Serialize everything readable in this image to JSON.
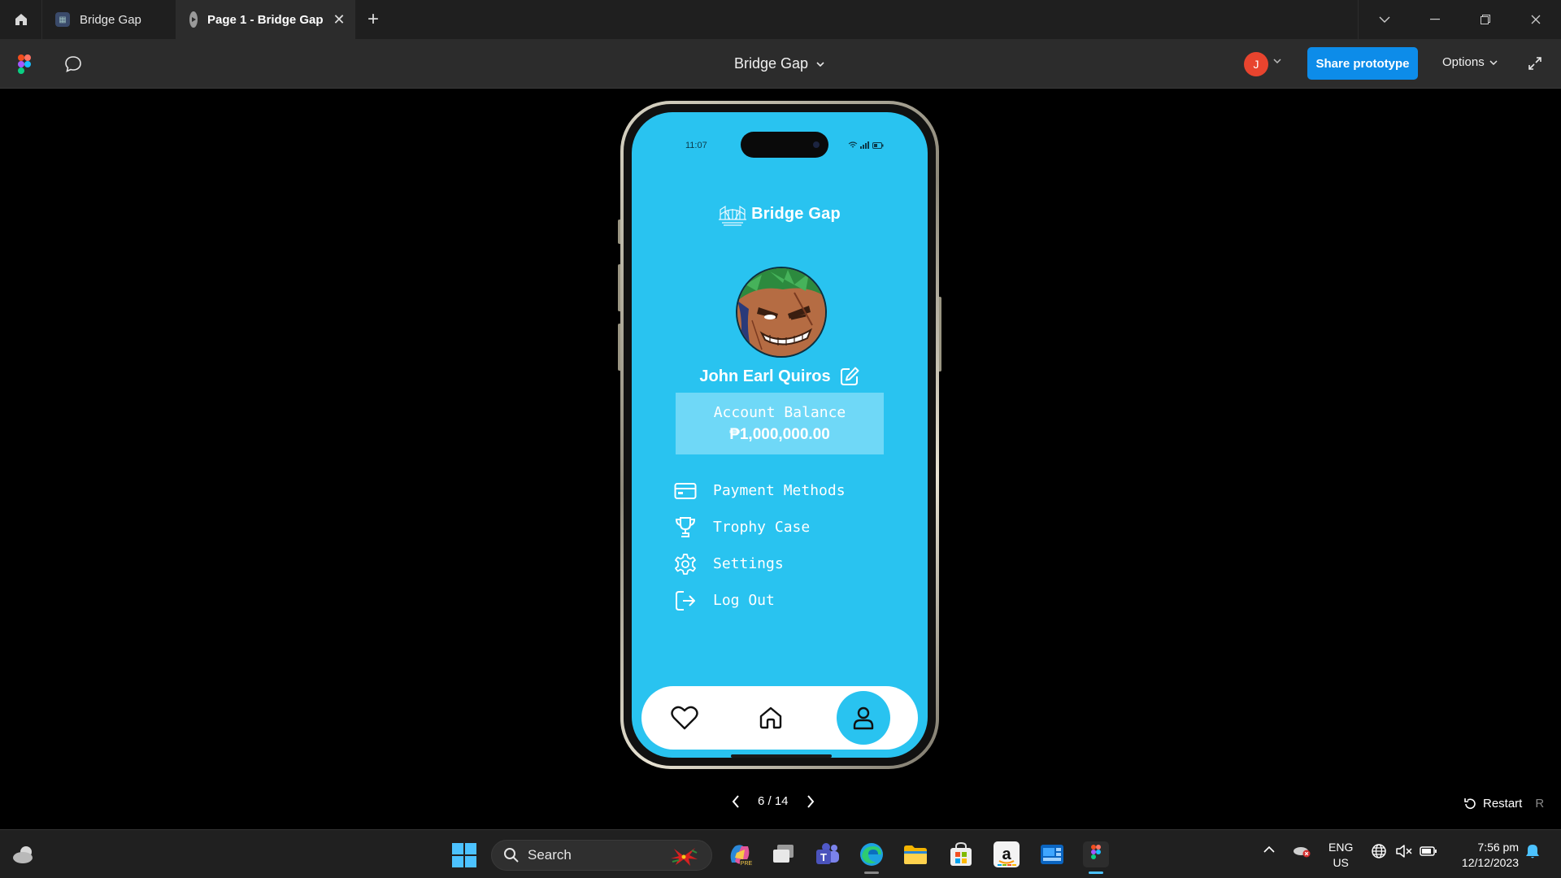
{
  "browser": {
    "tabs": [
      {
        "label": "Bridge Gap",
        "active": false
      },
      {
        "label": "Page 1 - Bridge Gap",
        "active": true
      }
    ]
  },
  "toolbar": {
    "file_title": "Bridge Gap",
    "user_initial": "J",
    "share_label": "Share prototype",
    "options_label": "Options"
  },
  "phone": {
    "status_time": "11:07",
    "brand": "Bridge Gap",
    "user_name": "John Earl Quiros",
    "balance_label": "Account Balance",
    "balance_value": "₱1,000,000.00",
    "menu": [
      {
        "label": "Payment Methods",
        "icon": "credit-card-icon"
      },
      {
        "label": "Trophy Case",
        "icon": "trophy-icon"
      },
      {
        "label": "Settings",
        "icon": "gear-icon"
      },
      {
        "label": "Log Out",
        "icon": "logout-icon"
      }
    ],
    "nav": [
      "heart-icon",
      "home-icon",
      "user-icon"
    ],
    "nav_active": "user-icon"
  },
  "pager": {
    "current": "6",
    "total": "14",
    "text": "6 / 14"
  },
  "restart": {
    "label": "Restart",
    "shortcut": "R"
  },
  "taskbar": {
    "search_placeholder": "Search",
    "lang_top": "ENG",
    "lang_bottom": "US",
    "time": "7:56 pm",
    "date": "12/12/2023"
  },
  "colors": {
    "screen_bg": "#29c3f0",
    "balance_bg": "#6fd8f7",
    "share_btn": "#0d8ce9",
    "avatar": "#e8442e"
  }
}
